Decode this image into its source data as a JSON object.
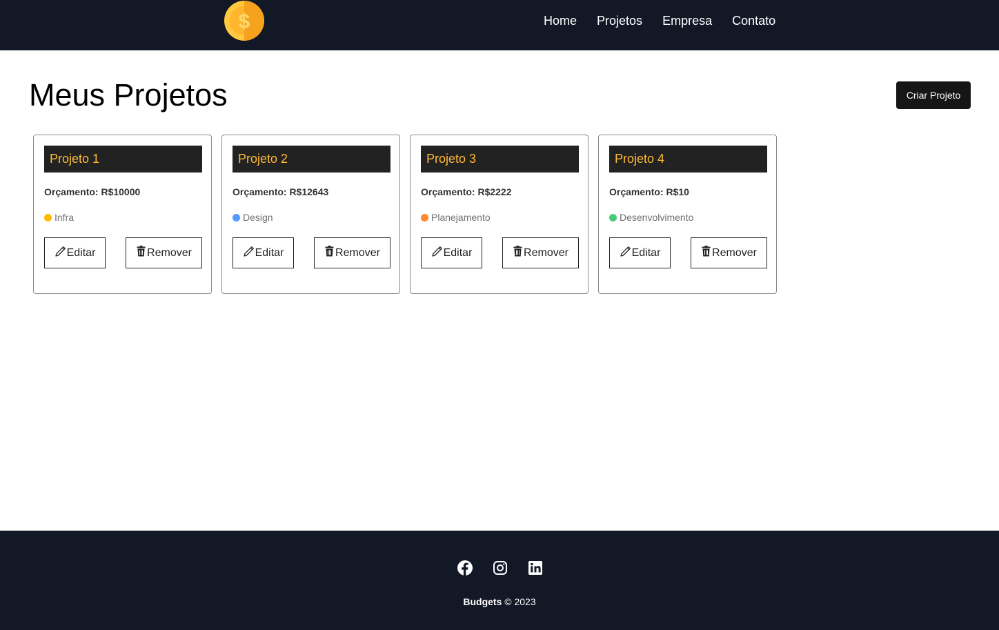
{
  "nav": {
    "links": [
      "Home",
      "Projetos",
      "Empresa",
      "Contato"
    ]
  },
  "page": {
    "title": "Meus Projetos",
    "create_button": "Criar Projeto"
  },
  "projects": [
    {
      "name": "Projeto 1",
      "budget": "Orçamento: R$10000",
      "category": "Infra",
      "color": "#ffbb00"
    },
    {
      "name": "Projeto 2",
      "budget": "Orçamento: R$12643",
      "category": "Design",
      "color": "#5599ff"
    },
    {
      "name": "Projeto 3",
      "budget": "Orçamento: R$2222",
      "category": "Planejamento",
      "color": "#ff8833"
    },
    {
      "name": "Projeto 4",
      "budget": "Orçamento: R$10",
      "category": "Desenvolvimento",
      "color": "#44cc77"
    }
  ],
  "card_actions": {
    "edit": "Editar",
    "remove": "Remover"
  },
  "footer": {
    "brand": "Budgets",
    "copyright": "© 2023",
    "socials": [
      "facebook-icon",
      "instagram-icon",
      "linkedin-icon"
    ]
  },
  "colors": {
    "nav_bg": "#121826",
    "card_title_bg": "#222222",
    "accent": "#ffbb33"
  }
}
